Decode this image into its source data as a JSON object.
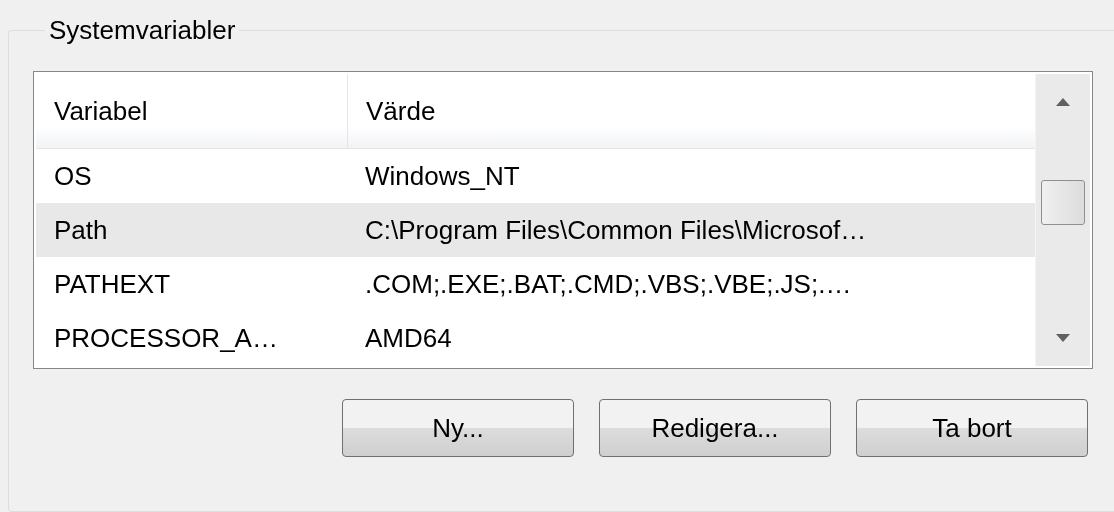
{
  "group": {
    "title": "Systemvariabler"
  },
  "table": {
    "columns": [
      "Variabel",
      "Värde"
    ],
    "rows": [
      {
        "variable": "OS",
        "value": "Windows_NT",
        "selected": false
      },
      {
        "variable": "Path",
        "value": "C:\\Program Files\\Common Files\\Microsof…",
        "selected": true
      },
      {
        "variable": "PATHEXT",
        "value": ".COM;.EXE;.BAT;.CMD;.VBS;.VBE;.JS;.…",
        "selected": false
      },
      {
        "variable": "PROCESSOR_A…",
        "value": "AMD64",
        "selected": false
      }
    ]
  },
  "buttons": [
    "Ny...",
    "Redigera...",
    "Ta bort"
  ]
}
